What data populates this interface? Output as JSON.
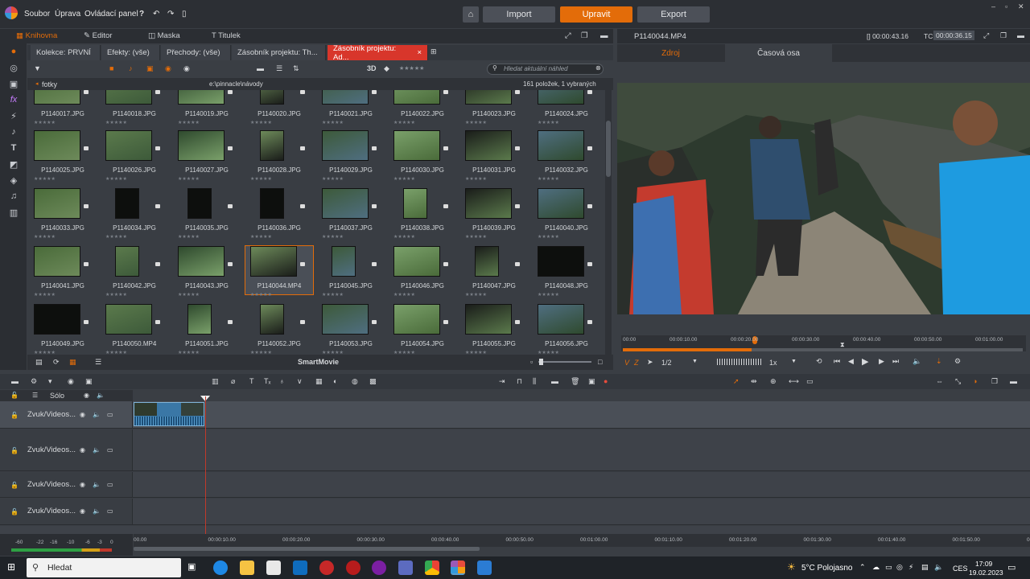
{
  "menubar": {
    "items": [
      "Soubor",
      "Úprava",
      "Ovládací panel"
    ]
  },
  "modes": {
    "import": "Import",
    "edit": "Upravit",
    "export": "Export"
  },
  "library_tabs": [
    "Knihovna",
    "Editor",
    "Maska",
    "Titulek"
  ],
  "collection_tabs": [
    "Kolekce: PRVNÍ",
    "Efekty: (vše)",
    "Přechody: (vše)",
    "Zásobník projektu: Th...",
    "Zásobník projektu: Ad..."
  ],
  "collection_close": "×",
  "view_mode": "3D",
  "search": {
    "placeholder": "Hledat aktuální náhled"
  },
  "folder": "fotky",
  "path": "e:\\pinnacle\\návody",
  "count": "161 položek, 1 vybraných",
  "items": [
    {
      "name": "P1140017.JPG"
    },
    {
      "name": "P1140018.JPG"
    },
    {
      "name": "P1140019.JPG"
    },
    {
      "name": "P1140020.JPG"
    },
    {
      "name": "P1140021.JPG"
    },
    {
      "name": "P1140022.JPG"
    },
    {
      "name": "P1140023.JPG"
    },
    {
      "name": "P1140024.JPG"
    },
    {
      "name": "P1140025.JPG"
    },
    {
      "name": "P1140026.JPG"
    },
    {
      "name": "P1140027.JPG"
    },
    {
      "name": "P1140028.JPG"
    },
    {
      "name": "P1140029.JPG"
    },
    {
      "name": "P1140030.JPG"
    },
    {
      "name": "P1140031.JPG"
    },
    {
      "name": "P1140032.JPG"
    },
    {
      "name": "P1140033.JPG"
    },
    {
      "name": "P1140034.JPG"
    },
    {
      "name": "P1140035.JPG"
    },
    {
      "name": "P1140036.JPG"
    },
    {
      "name": "P1140037.JPG"
    },
    {
      "name": "P1140038.JPG"
    },
    {
      "name": "P1140039.JPG"
    },
    {
      "name": "P1140040.JPG"
    },
    {
      "name": "P1140041.JPG"
    },
    {
      "name": "P1140042.JPG"
    },
    {
      "name": "P1140043.JPG"
    },
    {
      "name": "P1140044.MP4"
    },
    {
      "name": "P1140045.JPG"
    },
    {
      "name": "P1140046.JPG"
    },
    {
      "name": "P1140047.JPG"
    },
    {
      "name": "P1140048.JPG"
    },
    {
      "name": "P1140049.JPG"
    },
    {
      "name": "P1140050.MP4"
    },
    {
      "name": "P1140051.JPG"
    },
    {
      "name": "P1140052.JPG"
    },
    {
      "name": "P1140053.JPG"
    },
    {
      "name": "P1140054.JPG"
    },
    {
      "name": "P1140055.JPG"
    },
    {
      "name": "P1140056.JPG"
    }
  ],
  "stars": "★★★★★",
  "smartmovie": "SmartMovie",
  "preview": {
    "filename": "P1140044.MP4",
    "duration": "[] 00:00:43.16",
    "tc_label": "TC",
    "timecode": "00:00:36.15",
    "tabs": [
      "Zdroj",
      "Časová osa"
    ],
    "ruler": [
      "00:00",
      "00:00:10.00",
      "00:00:20.00",
      "00:00:30.00",
      "00:00:40.00",
      "00:00:50.00",
      "00:01:00.00"
    ],
    "marks": [
      "V",
      "Z"
    ],
    "fraction": "1/2",
    "speed": "1x"
  },
  "timeline": {
    "solo": "Sólo",
    "tracks": [
      "Zvuk/Videos...",
      "Zvuk/Videos...",
      "Zvuk/Videos...",
      "Zvuk/Videos..."
    ],
    "ruler": [
      "00.00",
      "00:00:10.00",
      "00:00:20.00",
      "00:00:30.00",
      "00:00:40.00",
      "00:00:50.00",
      "00:01:00.00",
      "00:01:10.00",
      "00:01:20.00",
      "00:01:30.00",
      "00:01:40.00",
      "00:01:50.00",
      "00:02:00"
    ],
    "meter_labels": [
      "-60",
      "-22",
      "-16",
      "-10",
      "-6",
      "-3",
      "0"
    ]
  },
  "taskbar": {
    "search": "Hledat",
    "weather": "5°C  Polojasno",
    "lang": "CES",
    "time": "17:09",
    "date": "19.02.2023"
  }
}
